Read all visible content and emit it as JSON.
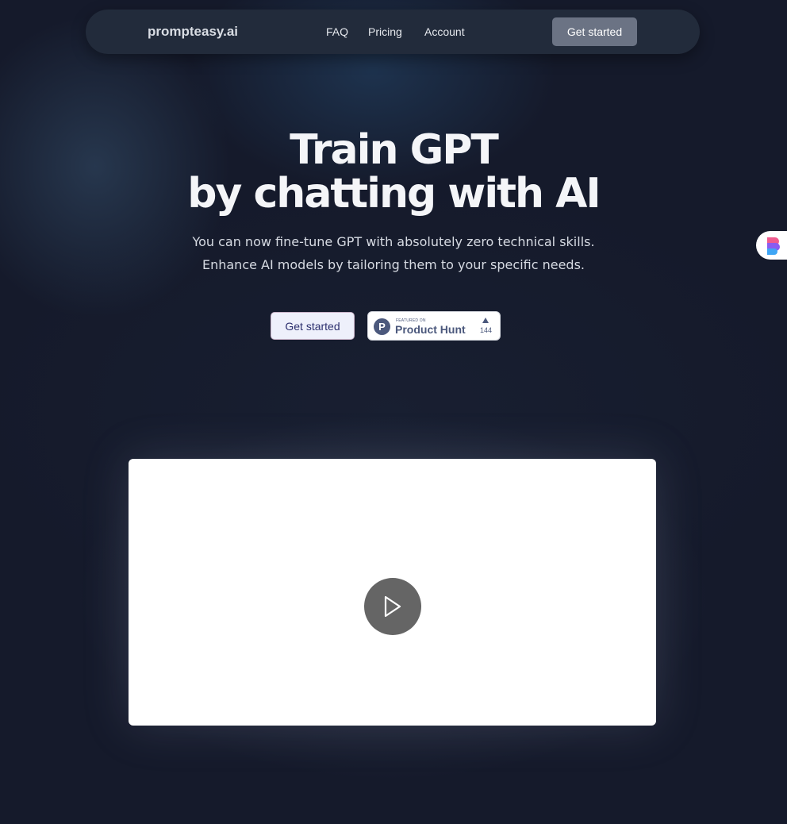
{
  "nav": {
    "brand": "prompteasy.ai",
    "links": [
      "FAQ",
      "Pricing",
      "Account"
    ],
    "cta": "Get started"
  },
  "hero": {
    "title_line_1": "Train GPT",
    "title_line_2": "by chatting with AI",
    "subtitle_line_1": "You can now fine-tune GPT with absolutely zero technical skills.",
    "subtitle_line_2": "Enhance AI models by tailoring them to your specific needs.",
    "cta": "Get started"
  },
  "product_hunt": {
    "featured_label": "FEATURED ON",
    "name": "Product Hunt",
    "logo_letter": "P",
    "upvotes": "144"
  },
  "video": {
    "play_icon": "play-icon"
  },
  "side_widget": {
    "icon": "app-widget-icon"
  },
  "colors": {
    "background": "#151a2b",
    "navbar": "#222b3b",
    "nav_cta": "#6b7384",
    "hero_cta_bg": "#eef0fb",
    "hero_cta_text": "#2c2f6e",
    "product_hunt": "#4b587c",
    "play_button": "#656565"
  }
}
